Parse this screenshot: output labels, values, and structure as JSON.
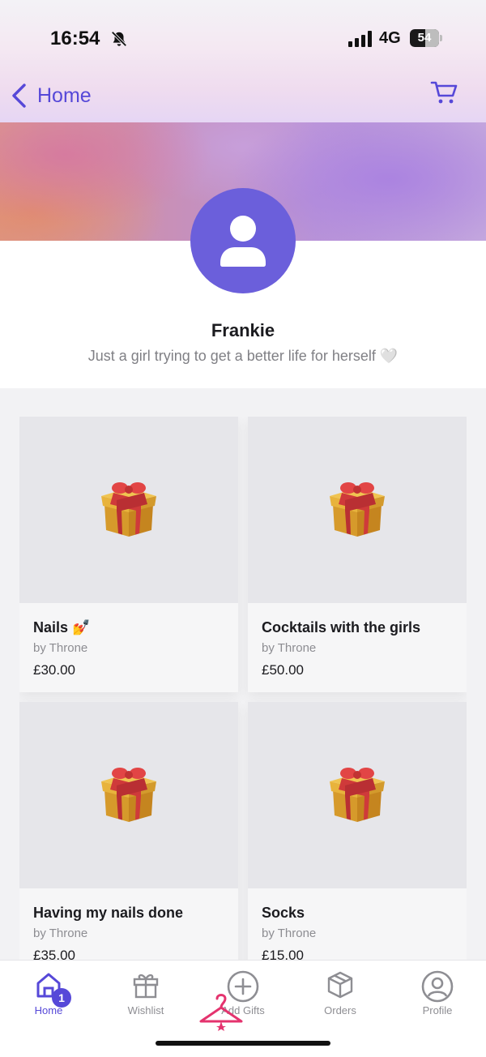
{
  "status_bar": {
    "time": "16:54",
    "network": "4G",
    "battery": "54",
    "battery_level": 0.54
  },
  "nav": {
    "back_label": "Home"
  },
  "profile": {
    "name": "Frankie",
    "bio": "Just a girl trying to get a better life for herself",
    "bio_emoji": "🤍"
  },
  "gifts": [
    {
      "title": "Nails 💅",
      "by": "by Throne",
      "price": "£30.00"
    },
    {
      "title": "Cocktails with the girls",
      "by": "by Throne",
      "price": "£50.00"
    },
    {
      "title": "Having my nails done",
      "by": "by Throne",
      "price": "£35.00"
    },
    {
      "title": "Socks",
      "by": "by Throne",
      "price": "£15.00"
    }
  ],
  "tabbar": {
    "home": "Home",
    "wishlist": "Wishlist",
    "add_gifts": "Add Gifts",
    "orders": "Orders",
    "profile": "Profile",
    "home_badge": "1"
  },
  "colors": {
    "accent": "#5648d8",
    "avatar": "#6b5fdb",
    "hanger": "#e4336e"
  },
  "icons": [
    "bell-slash-icon",
    "signal-icon",
    "back-chevron-icon",
    "cart-icon",
    "user-icon",
    "gift-box-icon",
    "home-icon",
    "gift-icon",
    "plus-circle-icon",
    "package-icon",
    "profile-circle-icon",
    "hanger-icon"
  ]
}
